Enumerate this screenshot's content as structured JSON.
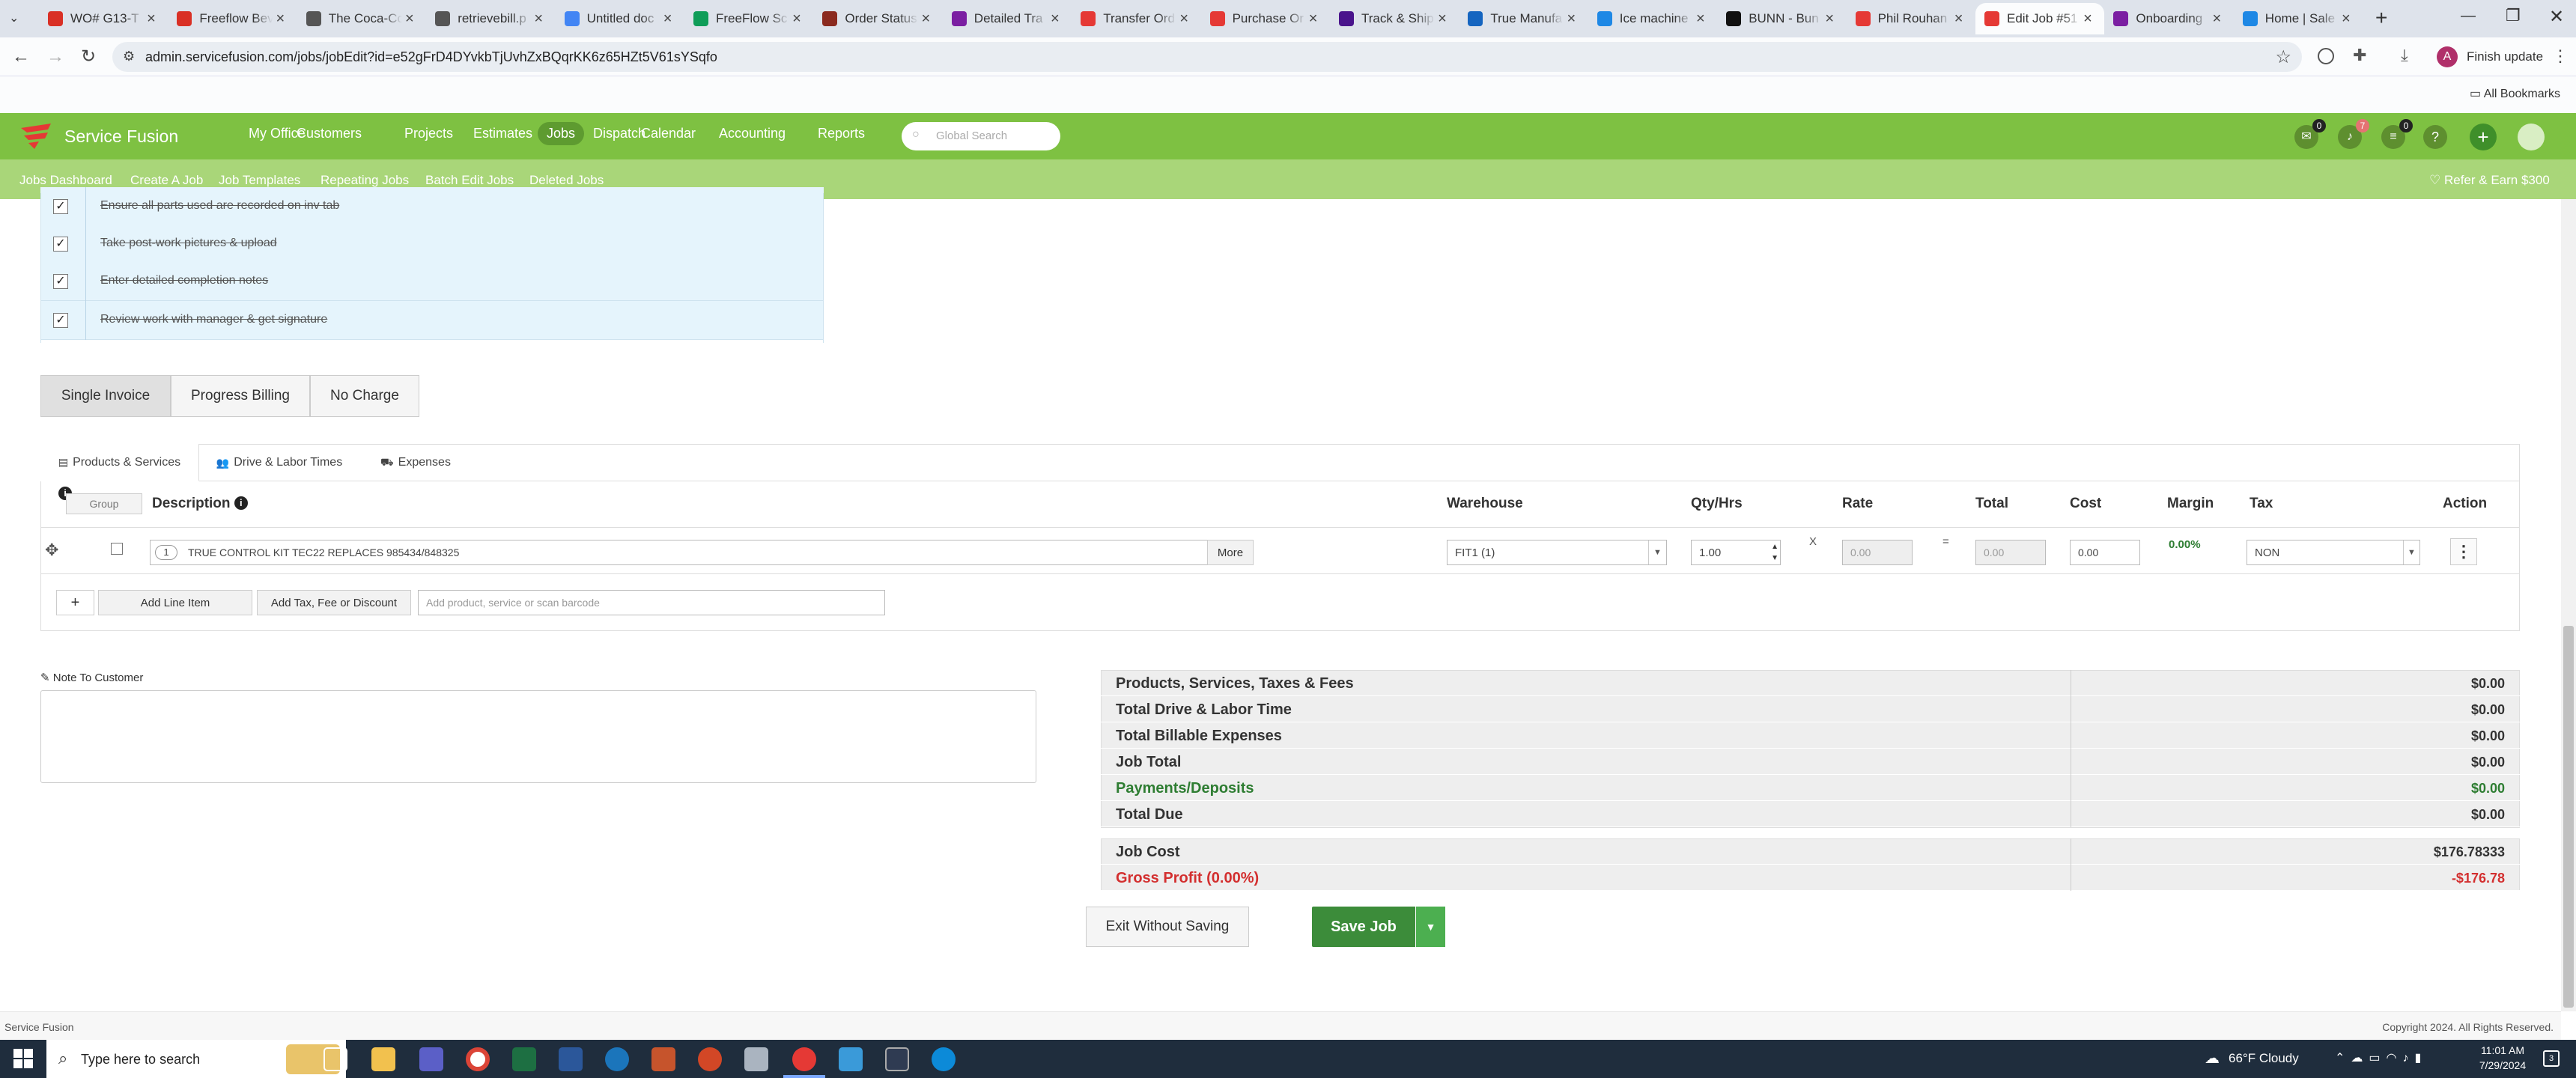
{
  "browser": {
    "tabs": [
      {
        "title": "WO# G13-T",
        "color": "#d93025"
      },
      {
        "title": "Freeflow Bev",
        "color": "#d93025"
      },
      {
        "title": "The Coca-Co",
        "color": "#555"
      },
      {
        "title": "retrievebill.p",
        "color": "#555"
      },
      {
        "title": "Untitled doc",
        "color": "#4285f4"
      },
      {
        "title": "FreeFlow Sc",
        "color": "#0f9d58"
      },
      {
        "title": "Order Status",
        "color": "#8b2a1f"
      },
      {
        "title": "Detailed Tra",
        "color": "#7b1fa2"
      },
      {
        "title": "Transfer Ord",
        "color": "#e53935"
      },
      {
        "title": "Purchase Or",
        "color": "#e53935"
      },
      {
        "title": "Track & Ship",
        "color": "#4a148c"
      },
      {
        "title": "True Manufa",
        "color": "#1565c0"
      },
      {
        "title": "Ice machine",
        "color": "#1e88e5"
      },
      {
        "title": "BUNN - Bun",
        "color": "#111"
      },
      {
        "title": "Phil Rouhan",
        "color": "#e53935"
      },
      {
        "title": "Edit Job #51",
        "color": "#e53935"
      },
      {
        "title": "Onboarding",
        "color": "#7b1fa2"
      },
      {
        "title": "Home | Sale",
        "color": "#1e88e5"
      }
    ],
    "url": "admin.servicefusion.com/jobs/jobEdit?id=e52gFrD4DYvkbTjUvhZxBQqrKK6z65HZt5V61sYSqfo",
    "finish_update": "Finish update",
    "all_bookmarks": "All Bookmarks",
    "profile_letter": "A"
  },
  "app": {
    "brand": "Service Fusion",
    "nav": [
      "My Office",
      "Customers",
      "Projects",
      "Estimates",
      "Jobs",
      "Dispatch",
      "Calendar",
      "Accounting",
      "Reports"
    ],
    "active_nav": "Jobs",
    "search_placeholder": "Global Search",
    "badges": {
      "chat": "0",
      "bell": "7",
      "list": "0"
    },
    "subnav": [
      "Jobs Dashboard",
      "Create A Job",
      "Job Templates",
      "Repeating Jobs",
      "Batch Edit Jobs",
      "Deleted Jobs"
    ],
    "refer": "Refer & Earn $300"
  },
  "checklist": [
    "Ensure all parts used are recorded on inv tab",
    "Take post-work pictures & upload",
    "Enter detailed completion notes",
    "Review work with manager & get signature"
  ],
  "billing_tabs": [
    "Single Invoice",
    "Progress Billing",
    "No Charge"
  ],
  "section_tabs": [
    "Products & Services",
    "Drive & Labor Times",
    "Expenses"
  ],
  "table": {
    "group_label": "Group",
    "headers": {
      "description": "Description",
      "warehouse": "Warehouse",
      "qty": "Qty/Hrs",
      "rate": "Rate",
      "total": "Total",
      "cost": "Cost",
      "margin": "Margin",
      "tax": "Tax",
      "action": "Action"
    },
    "row": {
      "num": "1",
      "description": "TRUE CONTROL KIT TEC22 REPLACES 985434/848325",
      "more": "More",
      "warehouse": "FIT1 (1)",
      "qty": "1.00",
      "x": "X",
      "rate": "0.00",
      "eq": "=",
      "total": "0.00",
      "cost": "0.00",
      "margin": "0.00%",
      "tax": "NON"
    },
    "add_line": "Add Line Item",
    "add_tax": "Add Tax, Fee or Discount",
    "add_placeholder": "Add product, service or scan barcode"
  },
  "note_label": "Note To Customer",
  "summary": [
    {
      "label": "Products, Services, Taxes & Fees",
      "value": "$0.00",
      "color": "#333"
    },
    {
      "label": "Total Drive & Labor Time",
      "value": "$0.00",
      "color": "#333"
    },
    {
      "label": "Total Billable Expenses",
      "value": "$0.00",
      "color": "#333"
    },
    {
      "label": "Job Total",
      "value": "$0.00",
      "color": "#333"
    },
    {
      "label": "Payments/Deposits",
      "value": "$0.00",
      "color": "#2e7d32"
    },
    {
      "label": "Total Due",
      "value": "$0.00",
      "color": "#333"
    }
  ],
  "cost_summary": [
    {
      "label": "Job Cost",
      "value": "$176.78333",
      "color": "#333"
    },
    {
      "label": "Gross Profit (0.00%)",
      "value": "-$176.78",
      "color": "#d32f2f"
    }
  ],
  "actions": {
    "exit": "Exit Without Saving",
    "save": "Save Job"
  },
  "footer": {
    "left": "Service Fusion",
    "right": "Copyright 2024. All Rights Reserved."
  },
  "taskbar": {
    "search": "Type here to search",
    "weather": "66°F  Cloudy",
    "time": "11:01 AM",
    "date": "7/29/2024",
    "notif": "3"
  }
}
